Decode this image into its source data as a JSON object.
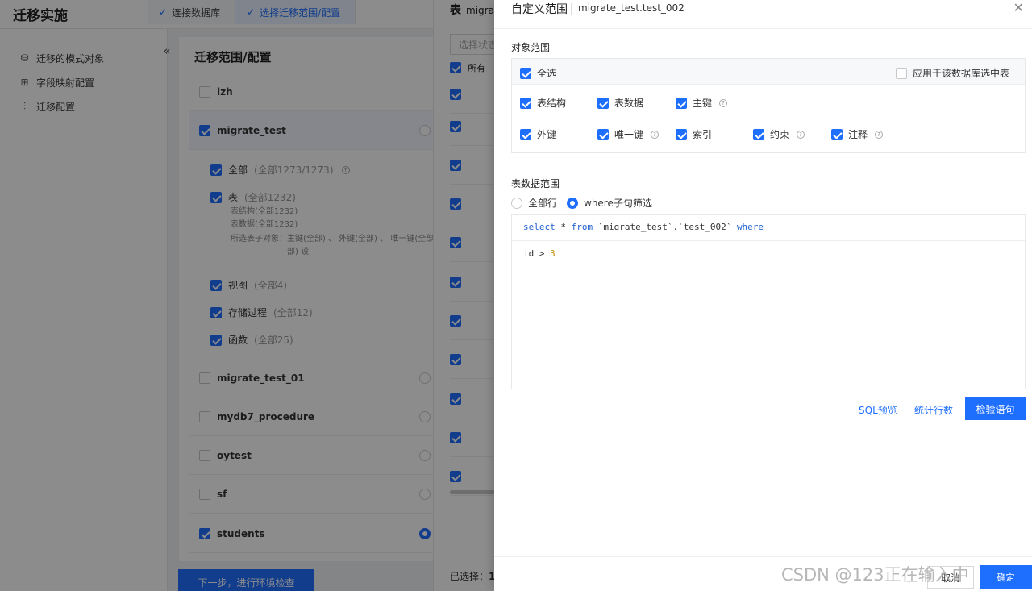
{
  "app": {
    "title": "迁移实施"
  },
  "steps": [
    {
      "label": "连接数据库",
      "active": false
    },
    {
      "label": "选择迁移范围/配置",
      "active": true
    }
  ],
  "left_nav": {
    "items": [
      {
        "label": "迁移的模式对象",
        "icon": "database-icon"
      },
      {
        "label": "字段映射配置",
        "icon": "table-map-icon"
      },
      {
        "label": "迁移配置",
        "icon": "sliders-icon"
      }
    ]
  },
  "main": {
    "title": "迁移范围/配置",
    "databases": [
      {
        "name": "lzh",
        "checked": false
      },
      {
        "name": "migrate_test",
        "checked": true
      },
      {
        "name": "migrate_test_01",
        "checked": false
      },
      {
        "name": "mydb7_procedure",
        "checked": false
      },
      {
        "name": "oytest",
        "checked": false
      },
      {
        "name": "sf",
        "checked": false
      },
      {
        "name": "students",
        "checked": true
      }
    ],
    "sub_items": {
      "all": {
        "label": "全部",
        "count": "(全部1273/1273)"
      },
      "table": {
        "label": "表",
        "count": "(全部1232)"
      },
      "table_detail_1": "表结构(全部1232)",
      "table_detail_2": "表数据(全部1232)",
      "table_detail_3": "所选表子对象：主键(全部) 、 外键(全部) 、 唯一键(全部",
      "table_detail_4": "部) 设",
      "view": {
        "label": "视图",
        "count": "(全部4)"
      },
      "procedure": {
        "label": "存储过程",
        "count": "(全部12)"
      },
      "function": {
        "label": "函数",
        "count": "(全部25)"
      }
    },
    "next_button": "下一步，进行环境检查"
  },
  "middle": {
    "title": "表",
    "title_suffix": "migra",
    "search_placeholder": "选择状态",
    "header_label": "所有",
    "selected_label": "已选择：",
    "selected_value": "1",
    "row_count": 11
  },
  "drawer": {
    "title": "自定义范围",
    "subtitle": "migrate_test.test_002",
    "object_scope_label": "对象范围",
    "select_all": "全选",
    "apply_all": "应用于该数据库选中表",
    "options": {
      "structure": "表结构",
      "data": "表数据",
      "primary_key": "主键",
      "foreign_key": "外键",
      "unique_key": "唯一键",
      "index": "索引",
      "constraint": "约束",
      "comment": "注释"
    },
    "data_scope_label": "表数据范围",
    "radio_all_rows": "全部行",
    "radio_where": "where子句筛选",
    "sql_prefix": "select * from `migrate_test`.`test_002` where",
    "sql_kw_select": "select",
    "sql_star": " * ",
    "sql_kw_from": "from",
    "sql_table": " `migrate_test`.`test_002` ",
    "sql_kw_where": "where",
    "where_id": "id > ",
    "where_num": "3",
    "sql_preview": "SQL预览",
    "count_rows": "统计行数",
    "validate": "检验语句",
    "cancel": "取消",
    "confirm": "确定"
  },
  "watermark": "CSDN @123正在输入中",
  "colors": {
    "accent": "#1f6fff",
    "overlay": "rgba(0,0,0,0.45)"
  }
}
